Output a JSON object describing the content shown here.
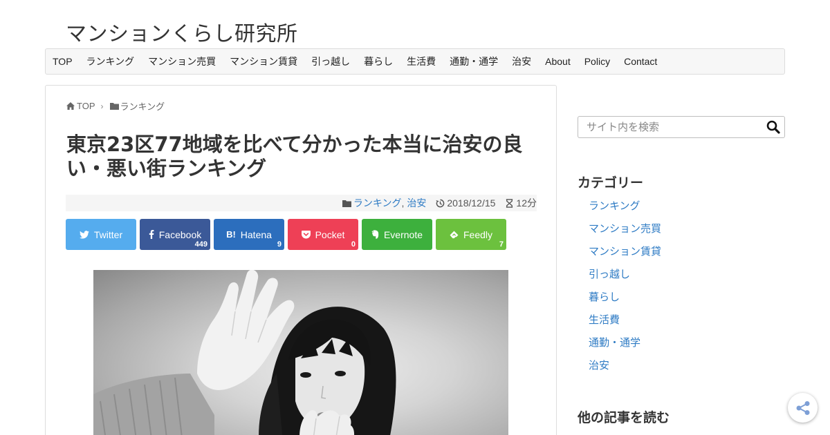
{
  "site": {
    "title": "マンションくらし研究所"
  },
  "nav": {
    "items": [
      "TOP",
      "ランキング",
      "マンション売買",
      "マンション賃貸",
      "引っ越し",
      "暮らし",
      "生活費",
      "通勤・通学",
      "治安",
      "About",
      "Policy",
      "Contact"
    ]
  },
  "breadcrumb": {
    "home": "TOP",
    "category": "ランキング"
  },
  "article": {
    "title": "東京23区77地域を比べて分かった本当に治安の良い・悪い街ランキング",
    "categories": [
      "ランキング",
      "治安"
    ],
    "category_separator": ",",
    "date": "2018/12/15",
    "read_time": "12分"
  },
  "share": {
    "buttons": [
      {
        "label": "Twitter",
        "count": "",
        "icon": "twitter-icon",
        "color": "#55acee"
      },
      {
        "label": "Facebook",
        "count": "449",
        "icon": "facebook-icon",
        "color": "#3b5998"
      },
      {
        "label": "Hatena",
        "count": "9",
        "icon": "hatena-icon",
        "color": "#2c6ebd"
      },
      {
        "label": "Pocket",
        "count": "0",
        "icon": "pocket-icon",
        "color": "#ee4056"
      },
      {
        "label": "Evernote",
        "count": "",
        "icon": "evernote-icon",
        "color": "#3db03d"
      },
      {
        "label": "Feedly",
        "count": "7",
        "icon": "feedly-icon",
        "color": "#6cc13e"
      }
    ]
  },
  "sidebar": {
    "search_placeholder": "サイト内を検索",
    "category_heading": "カテゴリー",
    "categories": [
      "ランキング",
      "マンション売買",
      "マンション賃貸",
      "引っ越し",
      "暮らし",
      "生活費",
      "通勤・通学",
      "治安"
    ],
    "other_heading": "他の記事を読む"
  },
  "colors": {
    "link": "#2e7bc4",
    "nav_bg": "#f7f7f7"
  }
}
